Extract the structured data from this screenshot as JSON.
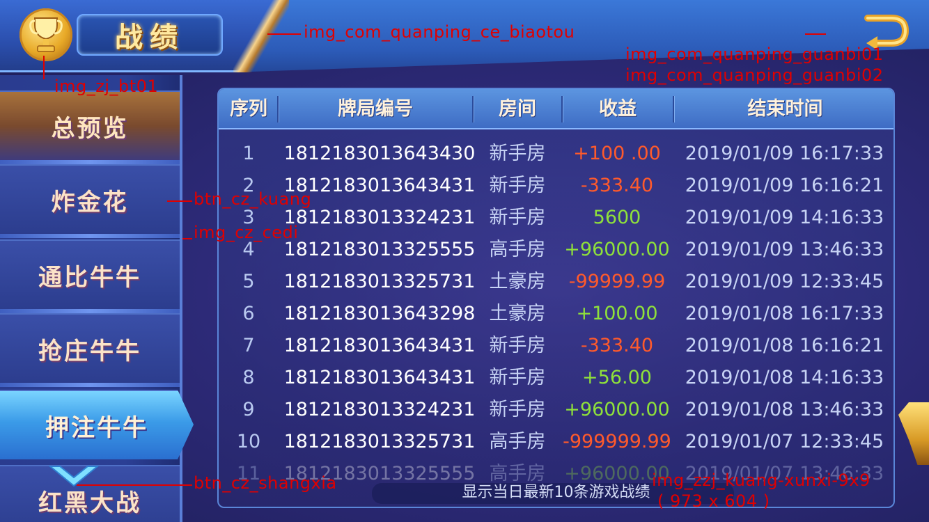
{
  "header": {
    "title": "战绩",
    "icons": {
      "trophy": "trophy-icon",
      "back": "back-arrow-icon"
    }
  },
  "annotations": {
    "header_strip": "img_com_quanping_ce_biaotou",
    "close_1": "img_com_quanping_guanbi01",
    "close_2": "img_com_quanping_guanbi02",
    "trophy": "img_zj_bt01",
    "tab_frame": "btn_cz_kuang",
    "tab_bg": "img_cz_cedi",
    "scroll": "btn_cz_shangxia",
    "panel": "img_zzj_kuang-xunxi-9x9",
    "panel_size": "( 973 x 604 )"
  },
  "sidebar": {
    "items": [
      {
        "label": "总预览"
      },
      {
        "label": "炸金花"
      },
      {
        "label": "通比牛牛"
      },
      {
        "label": "抢庄牛牛"
      },
      {
        "label": "押注牛牛"
      },
      {
        "label": "红黑大战"
      }
    ],
    "active_index": 4
  },
  "table": {
    "columns": [
      "序列",
      "牌局编号",
      "房间",
      "收益",
      "结束时间"
    ],
    "rows": [
      {
        "idx": "1",
        "id": "1812183013643430",
        "room": "新手房",
        "pnl": "+100 .00",
        "sign": "neg",
        "time": "2019/01/09 16:17:33"
      },
      {
        "idx": "2",
        "id": "1812183013643431",
        "room": "新手房",
        "pnl": "-333.40",
        "sign": "neg",
        "time": "2019/01/09 16:16:21"
      },
      {
        "idx": "3",
        "id": "1812183013324231",
        "room": "新手房",
        "pnl": "5600",
        "sign": "pos",
        "time": "2019/01/09 14:16:33"
      },
      {
        "idx": "4",
        "id": "1812183013325555",
        "room": "高手房",
        "pnl": "+96000.00",
        "sign": "pos",
        "time": "2019/01/09 13:46:33"
      },
      {
        "idx": "5",
        "id": "1812183013325731",
        "room": "土豪房",
        "pnl": "-99999.99",
        "sign": "neg",
        "time": "2019/01/09 12:33:45"
      },
      {
        "idx": "6",
        "id": "1812183013643298",
        "room": "土豪房",
        "pnl": "+100.00",
        "sign": "pos",
        "time": "2019/01/08 16:17:33"
      },
      {
        "idx": "7",
        "id": "1812183013643431",
        "room": "新手房",
        "pnl": "-333.40",
        "sign": "neg",
        "time": "2019/01/08 16:16:21"
      },
      {
        "idx": "8",
        "id": "1812183013643431",
        "room": "新手房",
        "pnl": "+56.00",
        "sign": "pos",
        "time": "2019/01/08 14:16:33"
      },
      {
        "idx": "9",
        "id": "1812183013324231",
        "room": "新手房",
        "pnl": "+96000.00",
        "sign": "pos",
        "time": "2019/01/08 13:46:33"
      },
      {
        "idx": "10",
        "id": "1812183013325731",
        "room": "高手房",
        "pnl": "-999999.99",
        "sign": "neg",
        "time": "2019/01/07 12:33:45"
      },
      {
        "idx": "11",
        "id": "1812183013325555",
        "room": "高手房",
        "pnl": "+96000.00",
        "sign": "pos",
        "time": "2019/01/07 13:46:33"
      }
    ],
    "footer": "显示当日最新10条游戏战绩"
  },
  "colors": {
    "negative": "#ff5a2b",
    "positive": "#8fe13a",
    "annotation": "#e00000"
  }
}
